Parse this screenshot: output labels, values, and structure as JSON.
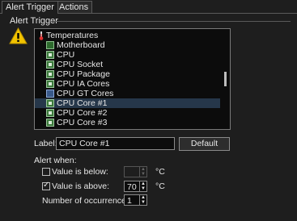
{
  "tabs": [
    {
      "label": "Alert Trigger",
      "active": true
    },
    {
      "label": "Actions",
      "active": false
    }
  ],
  "group_title": "Alert Trigger",
  "icon": "warning-icon",
  "tree": {
    "root": "Temperatures",
    "items": [
      {
        "label": "Motherboard",
        "icon": "motherboard-icon"
      },
      {
        "label": "CPU",
        "icon": "chip-icon"
      },
      {
        "label": "CPU Socket",
        "icon": "chip-icon"
      },
      {
        "label": "CPU Package",
        "icon": "chip-icon"
      },
      {
        "label": "CPU IA Cores",
        "icon": "chip-icon"
      },
      {
        "label": "CPU GT Cores",
        "icon": "gpu-icon"
      },
      {
        "label": "CPU Core #1",
        "icon": "chip-icon",
        "selected": true
      },
      {
        "label": "CPU Core #2",
        "icon": "chip-icon"
      },
      {
        "label": "CPU Core #3",
        "icon": "chip-icon"
      }
    ]
  },
  "label_field": {
    "caption": "Label:",
    "value": "CPU Core #1"
  },
  "default_button": "Default",
  "alert_when": "Alert when:",
  "below": {
    "label": "Value is below:",
    "checked": false,
    "value": "",
    "unit": "°C"
  },
  "above": {
    "label": "Value is above:",
    "checked": true,
    "value": "70",
    "unit": "°C"
  },
  "occurrences": {
    "label": "Number of occurrences:",
    "value": "1"
  }
}
